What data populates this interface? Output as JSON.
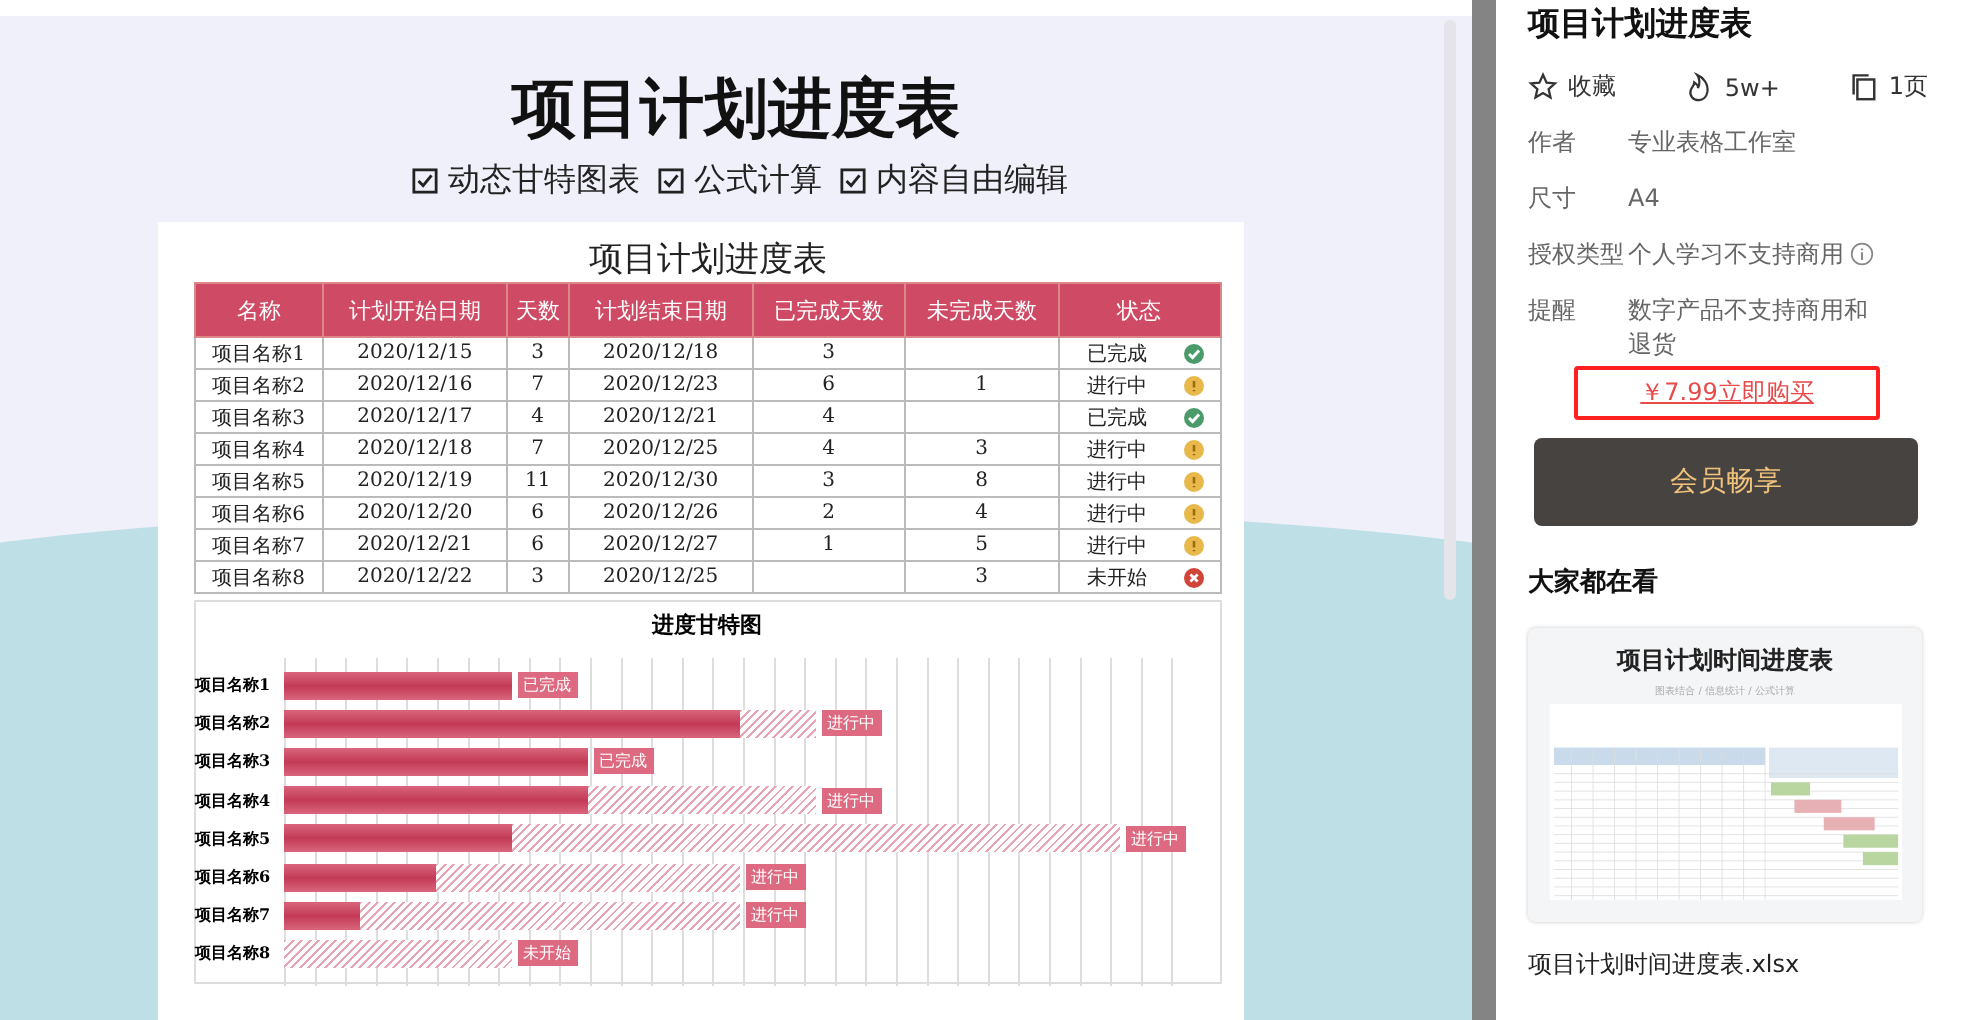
{
  "preview": {
    "title": "项目计划进度表",
    "features": [
      "动态甘特图表",
      "公式计算",
      "内容自由编辑"
    ],
    "sheet": {
      "title": "项目计划进度表",
      "columns": [
        "名称",
        "计划开始日期",
        "天数",
        "计划结束日期",
        "已完成天数",
        "未完成天数",
        "状态"
      ],
      "rows": [
        {
          "cells": [
            "项目名称1",
            "2020/12/15",
            "3",
            "2020/12/18",
            "3",
            ""
          ],
          "status": "已完成",
          "kind": "done"
        },
        {
          "cells": [
            "项目名称2",
            "2020/12/16",
            "7",
            "2020/12/23",
            "6",
            "1"
          ],
          "status": "进行中",
          "kind": "progress"
        },
        {
          "cells": [
            "项目名称3",
            "2020/12/17",
            "4",
            "2020/12/21",
            "4",
            ""
          ],
          "status": "已完成",
          "kind": "done"
        },
        {
          "cells": [
            "项目名称4",
            "2020/12/18",
            "7",
            "2020/12/25",
            "4",
            "3"
          ],
          "status": "进行中",
          "kind": "progress"
        },
        {
          "cells": [
            "项目名称5",
            "2020/12/19",
            "11",
            "2020/12/30",
            "3",
            "8"
          ],
          "status": "进行中",
          "kind": "progress"
        },
        {
          "cells": [
            "项目名称6",
            "2020/12/20",
            "6",
            "2020/12/26",
            "2",
            "4"
          ],
          "status": "进行中",
          "kind": "progress"
        },
        {
          "cells": [
            "项目名称7",
            "2020/12/21",
            "6",
            "2020/12/27",
            "1",
            "5"
          ],
          "status": "进行中",
          "kind": "progress"
        },
        {
          "cells": [
            "项目名称8",
            "2020/12/22",
            "3",
            "2020/12/25",
            "",
            "3"
          ],
          "status": "未开始",
          "kind": "not_started"
        }
      ]
    },
    "gantt": {
      "title": "进度甘特图",
      "rows": [
        {
          "name": "项目名称1",
          "label": "已完成"
        },
        {
          "name": "项目名称2",
          "label": "进行中"
        },
        {
          "name": "项目名称3",
          "label": "已完成"
        },
        {
          "name": "项目名称4",
          "label": "进行中"
        },
        {
          "name": "项目名称5",
          "label": "进行中"
        },
        {
          "name": "项目名称6",
          "label": "进行中"
        },
        {
          "name": "项目名称7",
          "label": "进行中"
        },
        {
          "name": "项目名称8",
          "label": "未开始"
        }
      ]
    }
  },
  "details": {
    "title": "项目计划进度表",
    "stats": [
      {
        "kind": "favorite",
        "text": "收藏"
      },
      {
        "kind": "views",
        "text": "5w+"
      },
      {
        "kind": "pages",
        "text": "1页"
      }
    ],
    "meta": [
      {
        "label": "作者",
        "value": "专业表格工作室"
      },
      {
        "label": "尺寸",
        "value": "A4"
      },
      {
        "label": "授权类型",
        "value": "个人学习不支持商用",
        "info": true
      },
      {
        "label": "提醒",
        "value": "数字产品不支持商用和退货"
      }
    ],
    "buy_link": "￥7.99立即购买",
    "member_button": "会员畅享",
    "related_heading": "大家都在看",
    "related": [
      {
        "thumb_title": "项目计划时间进度表",
        "thumb_subtitle": "图表结合 / 信息统计 / 公式计算",
        "filename": "项目计划时间进度表.xlsx"
      }
    ]
  }
}
